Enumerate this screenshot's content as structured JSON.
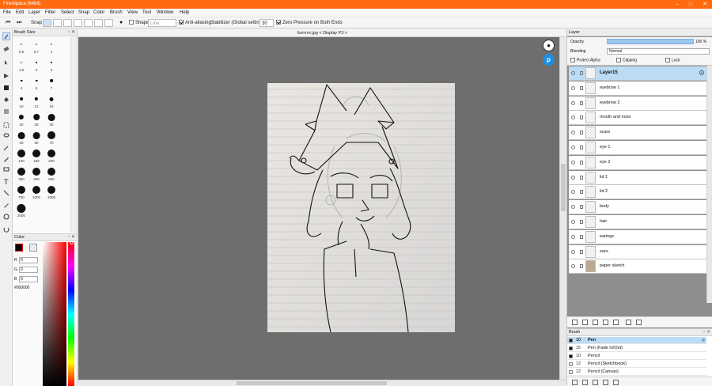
{
  "window": {
    "title": "FireAlpaca (64bit)",
    "minimize": "–",
    "maximize": "□",
    "close": "✕"
  },
  "menu": [
    "File",
    "Edit",
    "Layer",
    "Filter",
    "Select",
    "Snap",
    "Color",
    "Brush",
    "View",
    "Tool",
    "Window",
    "Help"
  ],
  "toolbar": {
    "snap_label": "Snap",
    "shape_label": "Shape",
    "shape_value": "Line",
    "antialiasing_label": "Anti-aliasing",
    "stabilizer_label": "Stabilizer (Global settings)",
    "stabilizer_value": "30",
    "zero_pressure_label": "Zero Pressure on Both Ends"
  },
  "brush_size": {
    "title": "Brush Size",
    "sizes": [
      "0.5",
      "0.7",
      "1",
      "1.5",
      "3",
      "3",
      "4",
      "5",
      "7",
      "10",
      "12",
      "15",
      "20",
      "25",
      "30",
      "40",
      "50",
      "70",
      "100",
      "150",
      "200",
      "300",
      "400",
      "500",
      "700",
      "1000",
      "1500",
      "2000"
    ]
  },
  "color_panel": {
    "title": "Color",
    "r_label": "R",
    "r_value": "0",
    "g_label": "G",
    "g_value": "0",
    "b_label": "B",
    "b_value": "0",
    "hex": "#000000",
    "primary_color": "#000000"
  },
  "document": {
    "tab_title": "furrrrrrr.jpg < Display P3 >"
  },
  "layer_panel": {
    "title": "Layer",
    "opacity_label": "Opacity",
    "opacity_value": "100 %",
    "opacity_fraction": 1.0,
    "blending_label": "Blending",
    "blending_value": "Normal",
    "protect_alpha_label": "Protect Alpha",
    "clipping_label": "Clipping",
    "lock_label": "Lock",
    "layers": [
      {
        "name": "Layer15",
        "selected": true
      },
      {
        "name": "eyebrow 1"
      },
      {
        "name": "eyebrow 2"
      },
      {
        "name": "mouth and nose"
      },
      {
        "name": "scars"
      },
      {
        "name": "eye 1"
      },
      {
        "name": "eye 2"
      },
      {
        "name": "lid 1"
      },
      {
        "name": "lid 2"
      },
      {
        "name": "body"
      },
      {
        "name": "hair"
      },
      {
        "name": "earings"
      },
      {
        "name": "ears"
      },
      {
        "name": "paper sketch"
      }
    ]
  },
  "brush_panel": {
    "title": "Brush",
    "brushes": [
      {
        "size": "10",
        "name": "Pen",
        "selected": true
      },
      {
        "size": "15",
        "name": "Pen (Fade In/Out)"
      },
      {
        "size": "10",
        "name": "Pencil"
      },
      {
        "size": "12",
        "name": "Pencil (Sketchbook)"
      },
      {
        "size": "12",
        "name": "Pencil (Canvas)"
      }
    ]
  },
  "colors": {
    "titlebar": "#ff6a0f",
    "selection": "#bcdcf5",
    "canvas_bg": "#6e6e6e"
  }
}
